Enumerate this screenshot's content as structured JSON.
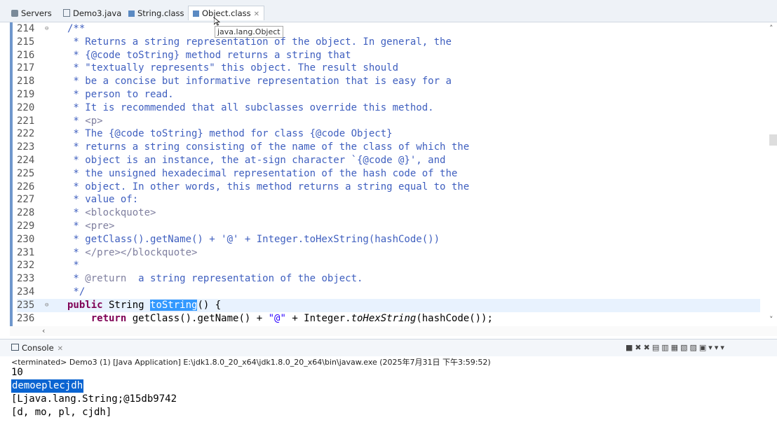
{
  "tabs": [
    {
      "label": "Servers"
    },
    {
      "label": "Demo3.java"
    },
    {
      "label": "String.class"
    },
    {
      "label": "Object.class",
      "close": "✕"
    }
  ],
  "tooltip": "java.lang.Object",
  "editor": {
    "lines": [
      {
        "n": "214",
        "t": "/**"
      },
      {
        "n": "215",
        "t": " * Returns a string representation of the object. In general, the"
      },
      {
        "n": "216",
        "t": " * {@code toString} method returns a string that"
      },
      {
        "n": "217",
        "t": " * \"textually represents\" this object. The result should"
      },
      {
        "n": "218",
        "t": " * be a concise but informative representation that is easy for a"
      },
      {
        "n": "219",
        "t": " * person to read."
      },
      {
        "n": "220",
        "t": " * It is recommended that all subclasses override this method."
      },
      {
        "n": "221",
        "t": " * <p>"
      },
      {
        "n": "222",
        "t": " * The {@code toString} method for class {@code Object}"
      },
      {
        "n": "223",
        "t": " * returns a string consisting of the name of the class of which the"
      },
      {
        "n": "224",
        "t": " * object is an instance, the at-sign character `{@code @}', and"
      },
      {
        "n": "225",
        "t": " * the unsigned hexadecimal representation of the hash code of the"
      },
      {
        "n": "226",
        "t": " * object. In other words, this method returns a string equal to the"
      },
      {
        "n": "227",
        "t": " * value of:"
      },
      {
        "n": "228",
        "t": " * <blockquote>"
      },
      {
        "n": "229",
        "t": " * <pre>"
      },
      {
        "n": "230",
        "t": " * getClass().getName() + '@' + Integer.toHexString(hashCode())"
      },
      {
        "n": "231",
        "t": " * </pre></blockquote>"
      },
      {
        "n": "232",
        "t": " *"
      },
      {
        "n": "233",
        "t": " * @return  a string representation of the object."
      },
      {
        "n": "234",
        "t": " */"
      },
      {
        "n": "235",
        "t": "public String toString() {"
      },
      {
        "n": "236",
        "t": "    return getClass().getName() + \"@\" + Integer.toHexString(hashCode());"
      }
    ]
  },
  "console": {
    "tab_label": "Console",
    "terminated": "<terminated> Demo3 (1) [Java Application] E:\\jdk1.8.0_20_x64\\jdk1.8.0_20_x64\\bin\\javaw.exe (2025年7月31日 下午3:59:52)",
    "output": [
      "10",
      "demoeplecjdh",
      "[Ljava.lang.String;@15db9742",
      "[d, mo, pl, cjdh]"
    ]
  }
}
